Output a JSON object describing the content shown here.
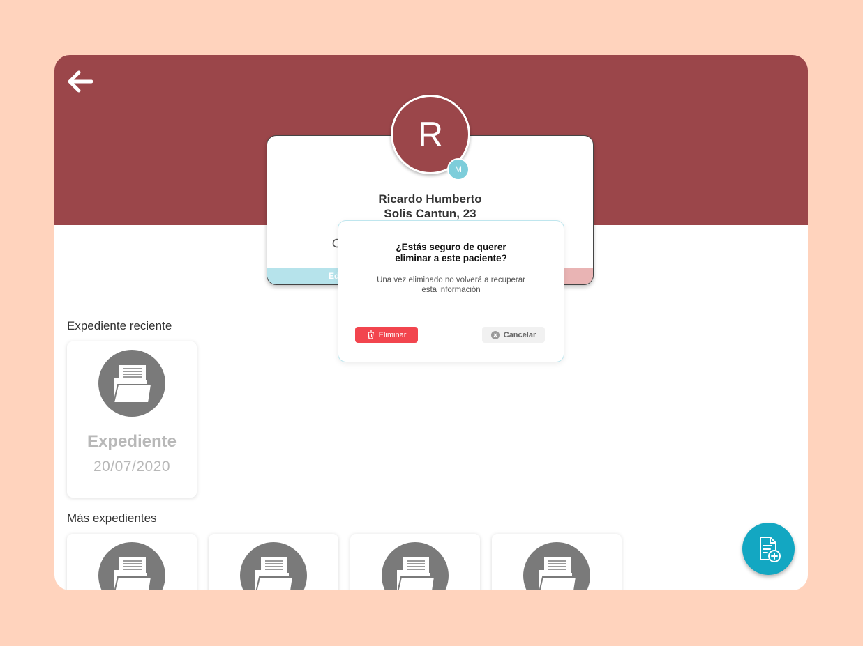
{
  "colors": {
    "background": "#FFD3BD",
    "header": "#9B464A",
    "accent": "#13A7C2",
    "danger": "#F2454E"
  },
  "header": {
    "back_icon": "arrow-left-icon"
  },
  "patient": {
    "initial": "R",
    "badge": "M",
    "name_line1": "Ricardo Humberto",
    "name_line2": "Solis Cantun, 23",
    "edit_label": "Ed"
  },
  "recent": {
    "title": "Expediente reciente",
    "record": {
      "title": "Expediente",
      "date": "20/07/2020"
    }
  },
  "more": {
    "title": "Más expedientes",
    "records": [
      {
        "icon": "folder-icon"
      },
      {
        "icon": "folder-icon"
      },
      {
        "icon": "folder-icon"
      },
      {
        "icon": "folder-icon"
      }
    ]
  },
  "dialog": {
    "title": "¿Estás seguro de querer\neliminar a este paciente?",
    "message": "Una vez eliminado no volverá a recuperar\nesta información",
    "confirm_label": "Eliminar",
    "cancel_label": "Cancelar"
  },
  "fab": {
    "icon": "add-document-icon"
  }
}
